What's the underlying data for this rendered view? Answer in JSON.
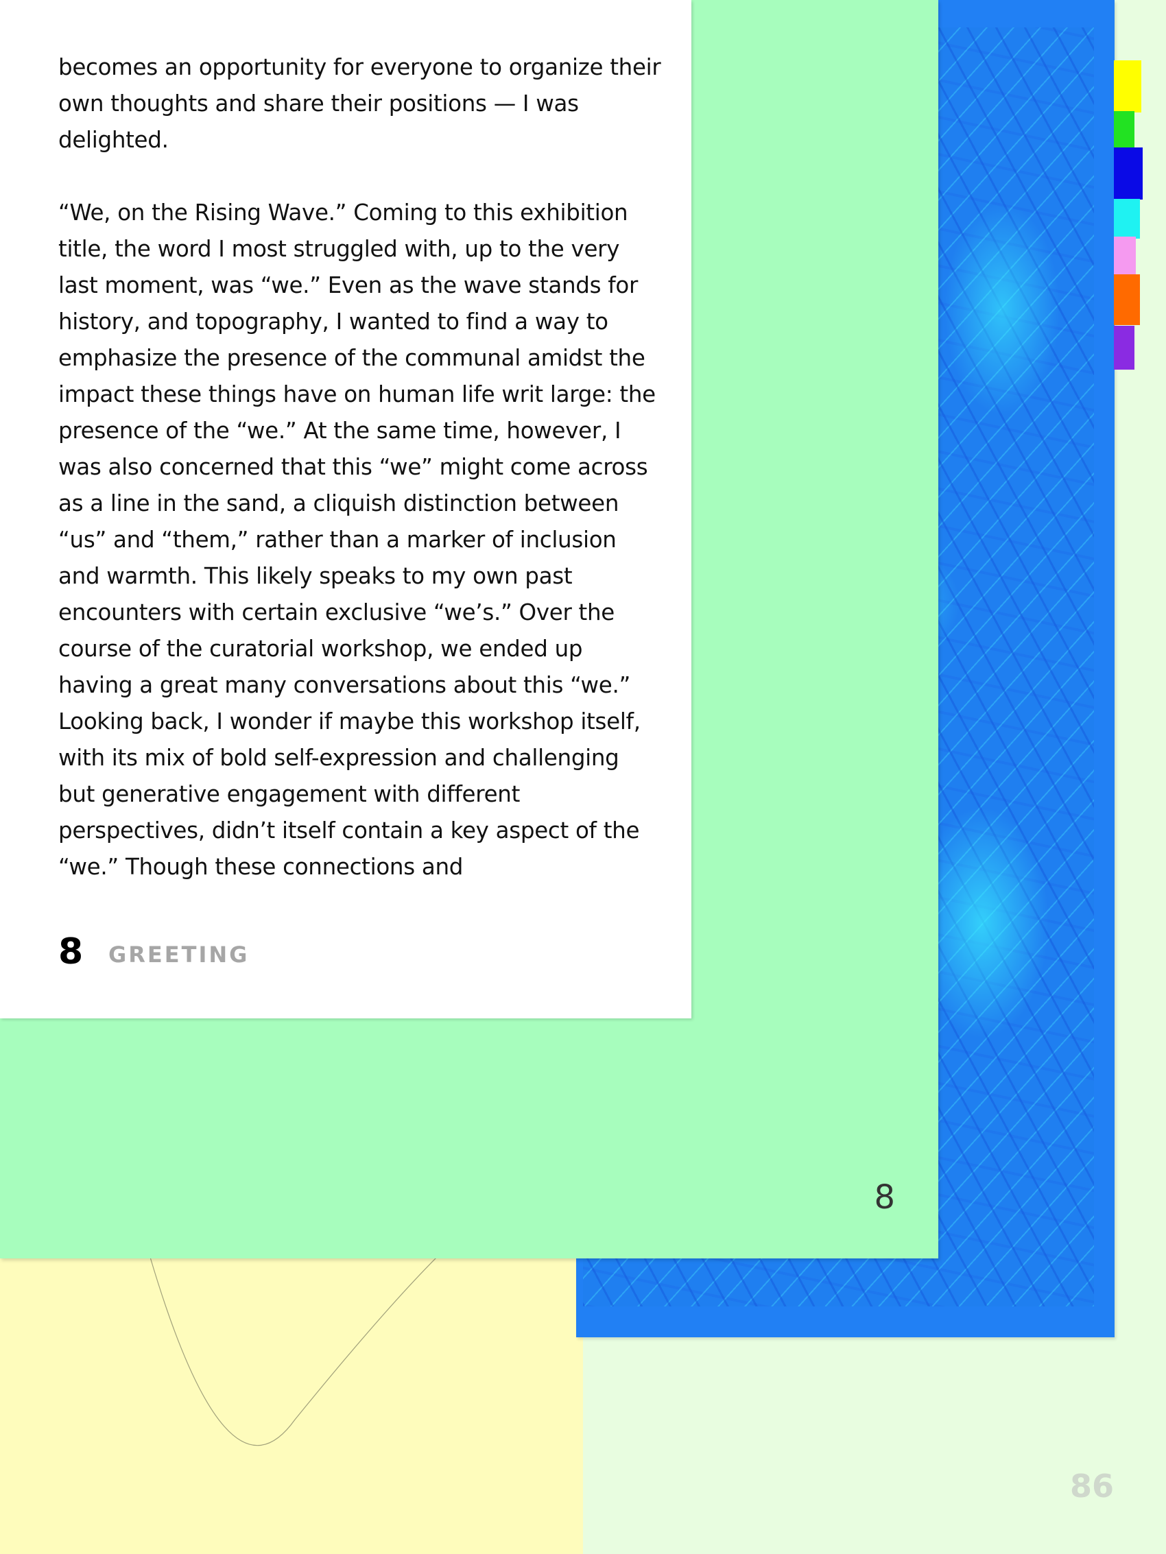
{
  "text_page": {
    "paragraphs": [
      "becomes an opportunity for everyone to organize their own thoughts and share their positions — I was delighted.",
      "“We, on the Rising Wave.” Coming to this exhibition title, the word I most struggled with, up to the very last moment, was “we.” Even as the wave stands for history, and topography, I wanted to find a way to emphasize the presence of the communal amidst the impact these things have on human life writ large: the presence of the “we.” At the same time, however, I was also concerned that this “we” might come across as a line in the sand, a cliquish distinction between “us” and “them,” rather than a marker of inclusion and warmth. This likely speaks to my own past encounters with certain exclusive “we’s.”  Over the course of the curatorial workshop, we ended up having a great many conversations about this “we.” Looking back, I wonder if maybe this workshop itself, with its mix of bold self-expression and challenging but generative engagement with different perspectives, didn’t itself contain a key aspect of the “we.” Though these connections and"
    ],
    "footer_number": "8",
    "footer_section": "GREETING"
  },
  "green_page_number": "8",
  "outer_page_number": "86",
  "colors": {
    "green_panel": "#a7fdbd",
    "blue_frame": "#2180f4",
    "yellow_panel": "#fefcbc",
    "outer_background": "#e8fde0"
  },
  "tabs": [
    {
      "color": "#ffff00"
    },
    {
      "color": "#22e222"
    },
    {
      "color": "#0a0ae6"
    },
    {
      "color": "#1ff2f2"
    },
    {
      "color": "#f59af0"
    },
    {
      "color": "#ff6a00"
    },
    {
      "color": "#8a2be2"
    }
  ]
}
